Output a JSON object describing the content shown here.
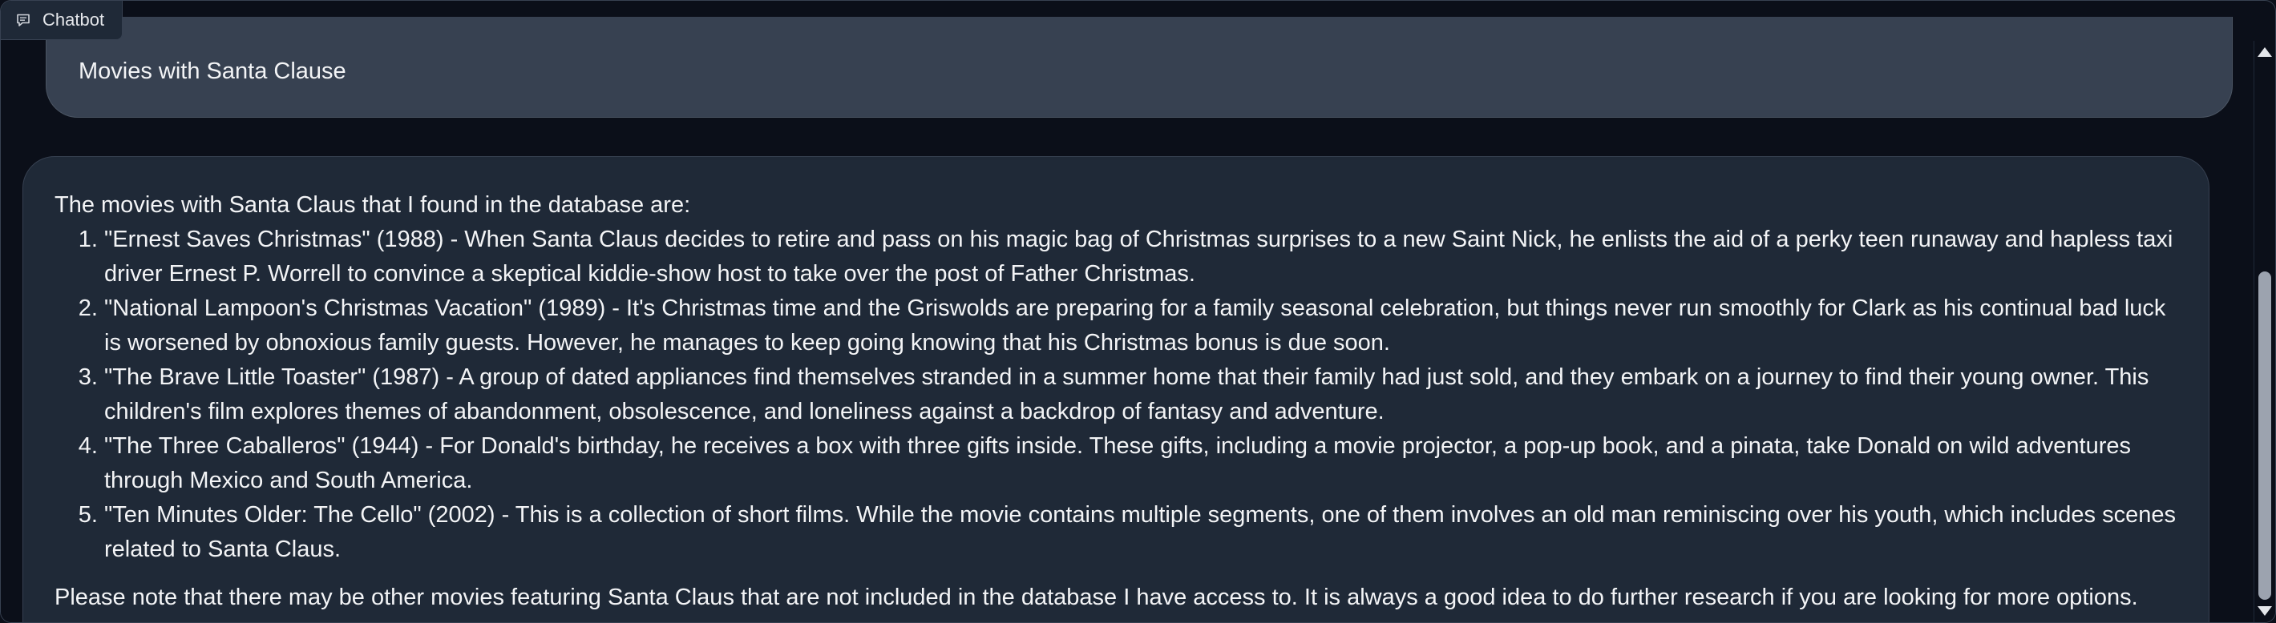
{
  "header": {
    "label": "Chatbot",
    "icon": "chat-bubble-icon"
  },
  "messages": {
    "user": {
      "text": "Movies with Santa Clause"
    },
    "bot": {
      "intro": "The movies with Santa Claus that I found in the database are:",
      "items": [
        "\"Ernest Saves Christmas\" (1988) - When Santa Claus decides to retire and pass on his magic bag of Christmas surprises to a new Saint Nick, he enlists the aid of a perky teen runaway and hapless taxi driver Ernest P. Worrell to convince a skeptical kiddie-show host to take over the post of Father Christmas.",
        "\"National Lampoon's Christmas Vacation\" (1989) - It's Christmas time and the Griswolds are preparing for a family seasonal celebration, but things never run smoothly for Clark as his continual bad luck is worsened by obnoxious family guests. However, he manages to keep going knowing that his Christmas bonus is due soon.",
        "\"The Brave Little Toaster\" (1987) - A group of dated appliances find themselves stranded in a summer home that their family had just sold, and they embark on a journey to find their young owner. This children's film explores themes of abandonment, obsolescence, and loneliness against a backdrop of fantasy and adventure.",
        "\"The Three Caballeros\" (1944) - For Donald's birthday, he receives a box with three gifts inside. These gifts, including a movie projector, a pop-up book, and a pinata, take Donald on wild adventures through Mexico and South America.",
        "\"Ten Minutes Older: The Cello\" (2002) - This is a collection of short films. While the movie contains multiple segments, one of them involves an old man reminiscing over his youth, which includes scenes related to Santa Claus."
      ],
      "note": "Please note that there may be other movies featuring Santa Claus that are not included in the database I have access to. It is always a good idea to do further research if you are looking for more options."
    }
  },
  "colors": {
    "background": "#0b0f19",
    "user_bubble": "#374151",
    "bot_bubble": "#1f2937",
    "text": "#f3f4f6"
  }
}
